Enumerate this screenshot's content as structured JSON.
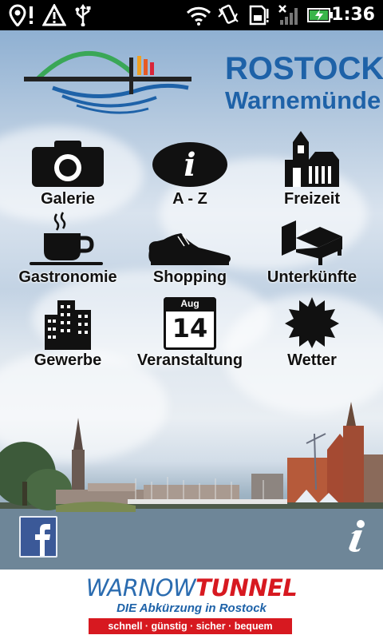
{
  "status_bar": {
    "time": "1:36",
    "icons": [
      "location-pin-icon",
      "warning-icon",
      "usb-icon",
      "wifi-icon",
      "vibrate-icon",
      "sd-card-icon",
      "no-signal-icon",
      "battery-charging-icon"
    ]
  },
  "logo": {
    "title": "ROSTOCK",
    "subtitle": "Warnemünde",
    "colors": {
      "brand_blue": "#1e62a8",
      "green": "#3aa757"
    }
  },
  "menu": {
    "items": [
      {
        "id": "galerie",
        "label": "Galerie",
        "icon": "camera-icon"
      },
      {
        "id": "a-z",
        "label": "A - Z",
        "icon": "info-icon"
      },
      {
        "id": "freizeit",
        "label": "Freizeit",
        "icon": "church-icon"
      },
      {
        "id": "gastronomie",
        "label": "Gastronomie",
        "icon": "coffee-cup-icon"
      },
      {
        "id": "shopping",
        "label": "Shopping",
        "icon": "shoe-icon"
      },
      {
        "id": "unterkunfte",
        "label": "Unterkünfte",
        "icon": "bed-icon"
      },
      {
        "id": "gewerbe",
        "label": "Gewerbe",
        "icon": "buildings-icon"
      },
      {
        "id": "veranstaltung",
        "label": "Veranstaltung",
        "icon": "calendar-icon",
        "calendar_month": "Aug",
        "calendar_day": "14"
      },
      {
        "id": "wetter",
        "label": "Wetter",
        "icon": "sun-icon"
      }
    ]
  },
  "bottom": {
    "facebook_icon": "facebook-icon",
    "info_icon": "info-icon"
  },
  "banner": {
    "title_part1": "WARNOW",
    "title_part2": "TUNNEL",
    "subtitle": "DIE Abkürzung in Rostock",
    "slogan": "schnell · günstig · sicher · bequem",
    "colors": {
      "blue": "#2b6cb0",
      "red": "#d71920"
    }
  }
}
